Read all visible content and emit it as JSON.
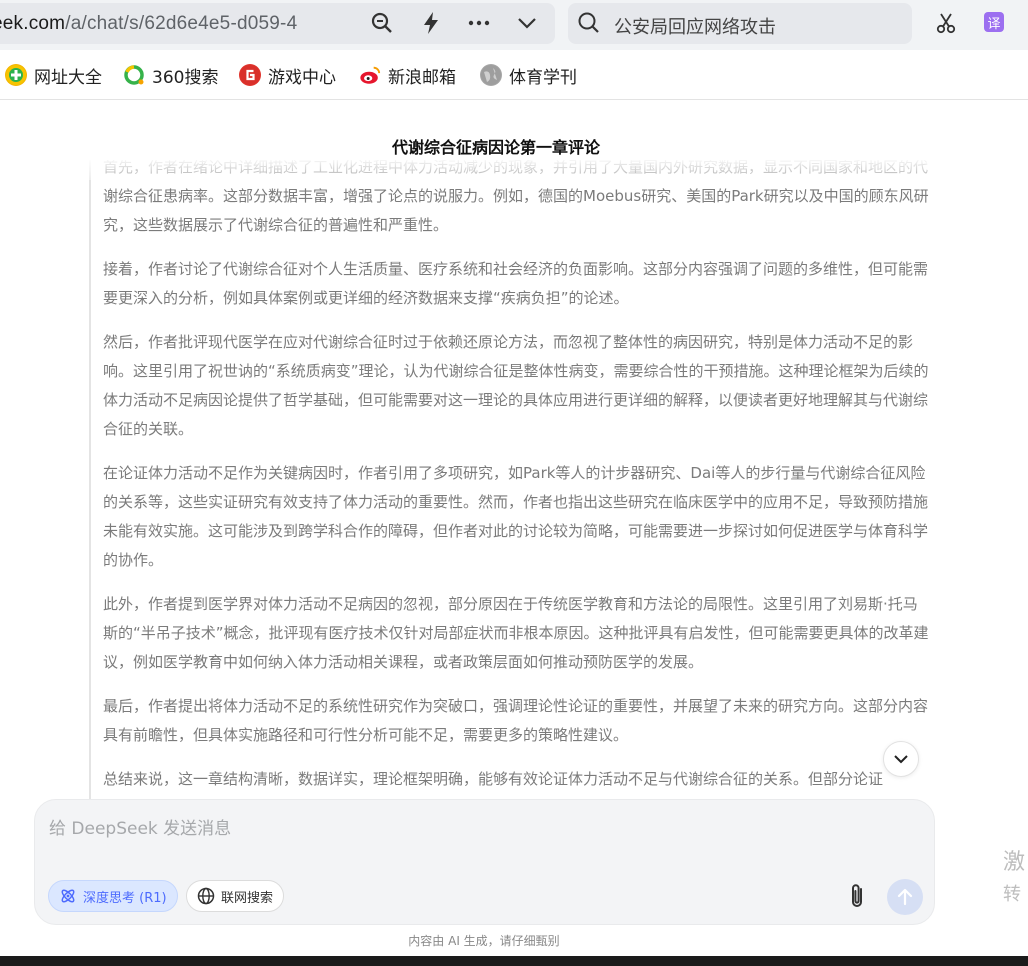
{
  "browser": {
    "url_host": "eek.com",
    "url_path": "/a/chat/s/62d6e4e5-d059-4",
    "search_query": "公安局回应网络攻击",
    "translate_label": "译"
  },
  "bookmarks": [
    {
      "label": "网址大全",
      "icon": "plus-circle-icon",
      "color": "#f4b400"
    },
    {
      "label": "360搜索",
      "icon": "360-search-icon",
      "color": "#36b24a"
    },
    {
      "label": "游戏中心",
      "icon": "game-center-icon",
      "color": "#e0342c"
    },
    {
      "label": "新浪邮箱",
      "icon": "sina-mail-icon",
      "color": "#e6162d"
    },
    {
      "label": "体育学刊",
      "icon": "globe-icon",
      "color": "#9e9e9e"
    }
  ],
  "document": {
    "title": "代谢综合征病因论第一章评论",
    "paragraphs": [
      "首先，作者在绪论中详细描述了工业化进程中体力活动减少的现象，并引用了大量国内外研究数据，显示不同国家和地区的代谢综合征患病率。这部分数据丰富，增强了论点的说服力。例如，德国的Moebus研究、美国的Park研究以及中国的顾东风研究，这些数据展示了代谢综合征的普遍性和严重性。",
      "接着，作者讨论了代谢综合征对个人生活质量、医疗系统和社会经济的负面影响。这部分内容强调了问题的多维性，但可能需要更深入的分析，例如具体案例或更详细的经济数据来支撑“疾病负担”的论述。",
      "然后，作者批评现代医学在应对代谢综合征时过于依赖还原论方法，而忽视了整体性的病因研究，特别是体力活动不足的影响。这里引用了祝世讷的“系统质病变”理论，认为代谢综合征是整体性病变，需要综合性的干预措施。这种理论框架为后续的体力活动不足病因论提供了哲学基础，但可能需要对这一理论的具体应用进行更详细的解释，以便读者更好地理解其与代谢综合征的关联。",
      "在论证体力活动不足作为关键病因时，作者引用了多项研究，如Park等人的计步器研究、Dai等人的步行量与代谢综合征风险的关系等，这些实证研究有效支持了体力活动的重要性。然而，作者也指出这些研究在临床医学中的应用不足，导致预防措施未能有效实施。这可能涉及到跨学科合作的障碍，但作者对此的讨论较为简略，可能需要进一步探讨如何促进医学与体育科学的协作。",
      "此外，作者提到医学界对体力活动不足病因的忽视，部分原因在于传统医学教育和方法论的局限性。这里引用了刘易斯·托马斯的“半吊子技术”概念，批评现有医疗技术仅针对局部症状而非根本原因。这种批评具有启发性，但可能需要更具体的改革建议，例如医学教育中如何纳入体力活动相关课程，或者政策层面如何推动预防医学的发展。",
      "最后，作者提出将体力活动不足的系统性研究作为突破口，强调理论性论证的重要性，并展望了未来的研究方向。这部分内容具有前瞻性，但具体实施路径和可行性分析可能不足，需要更多的策略性建议。",
      "总结来说，这一章结构清晰，数据详实，理论框架明确，能够有效论证体力活动不足与代谢综合征的关系。但部分论证"
    ]
  },
  "composer": {
    "placeholder": "给 DeepSeek 发送消息",
    "deep_think_label": "深度思考 (R1)",
    "web_search_label": "联网搜索",
    "accent_color": "#4d6bfe"
  },
  "disclaimer": "内容由 AI 生成，请仔细甄别",
  "side_panel": {
    "line1": "激",
    "line2": "转"
  }
}
